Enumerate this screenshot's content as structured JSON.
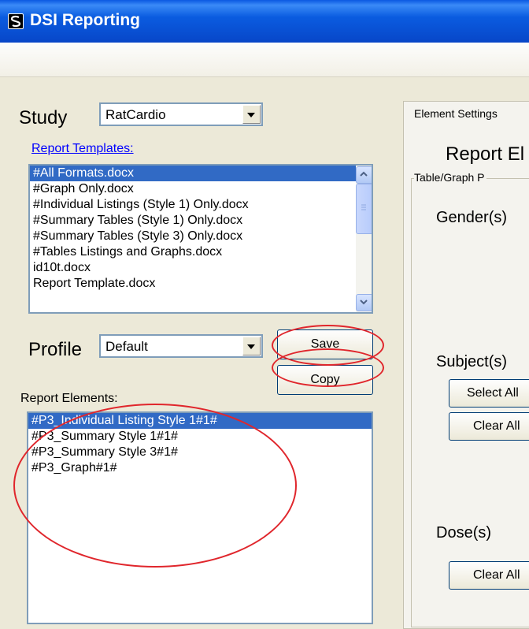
{
  "window": {
    "title": "DSI Reporting"
  },
  "study": {
    "label": "Study",
    "value": "RatCardio"
  },
  "templates": {
    "label": "Report Templates:",
    "items": [
      "#All Formats.docx",
      "#Graph Only.docx",
      "#Individual Listings (Style 1) Only.docx",
      "#Summary Tables (Style 1) Only.docx",
      "#Summary Tables (Style 3) Only.docx",
      "#Tables Listings and Graphs.docx",
      "id10t.docx",
      "Report Template.docx"
    ]
  },
  "profile": {
    "label": "Profile",
    "value": "Default",
    "save_label": "Save",
    "copy_label": "Copy"
  },
  "elements": {
    "label": "Report Elements:",
    "items": [
      "#P3_Individual Listing Style 1#1#",
      "#P3_Summary Style 1#1#",
      "#P3_Summary Style 3#1#",
      "#P3_Graph#1#"
    ]
  },
  "settings": {
    "tab_label": "Element Settings",
    "heading": "Report El",
    "group_label": "Table/Graph P",
    "gender_label": "Gender(s)",
    "subject_label": "Subject(s)",
    "select_all_label": "Select All",
    "clear_all_label": "Clear All",
    "dose_label": "Dose(s)",
    "dose_clear_all_label": "Clear All"
  },
  "colors": {
    "titlebar": "#0a5ce0",
    "selection": "#316ac5",
    "annotation": "#e0262c",
    "link": "#0000ff"
  }
}
